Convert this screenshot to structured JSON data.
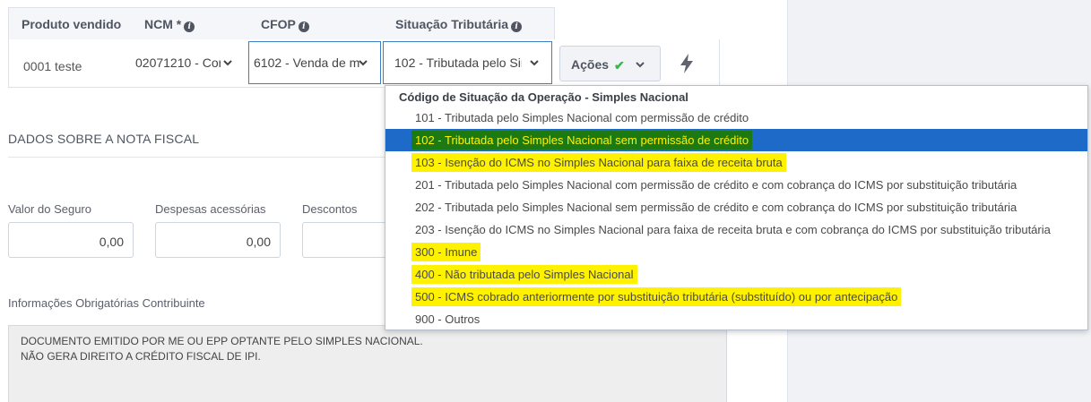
{
  "table": {
    "headers": {
      "produto": "Produto vendido",
      "ncm": "NCM *",
      "cfop": "CFOP",
      "situacao": "Situação Tributária"
    },
    "row": {
      "produto": "0001 teste",
      "ncm": "02071210 - Cor",
      "cfop": "6102 - Venda de m",
      "situacao": "102 - Tributada pelo Sir"
    },
    "acoes_label": "Ações"
  },
  "section": {
    "title": "DADOS SOBRE A NOTA FISCAL"
  },
  "fields": {
    "seguro_label": "Valor do Seguro",
    "seguro_value": "0,00",
    "despesas_label": "Despesas acessórias",
    "despesas_value": "0,00",
    "descontos_label": "Descontos"
  },
  "info": {
    "label": "Informações Obrigatórias Contribuinte",
    "line1": "DOCUMENTO EMITIDO POR ME OU EPP OPTANTE PELO SIMPLES NACIONAL.",
    "line2": "NÃO GERA DIREITO A CRÉDITO FISCAL DE IPI."
  },
  "dropdown": {
    "group": "Código de Situação da Operação - Simples Nacional",
    "options": [
      {
        "label": "101 - Tributada pelo Simples Nacional com permissão de crédito",
        "state": "normal"
      },
      {
        "label": "102 - Tributada pelo Simples Nacional sem permissão de crédito",
        "state": "selected"
      },
      {
        "label": "103 - Isenção do ICMS no Simples Nacional para faixa de receita bruta",
        "state": "highlighted"
      },
      {
        "label": "201 - Tributada pelo Simples Nacional com permissão de crédito e com cobrança do ICMS por substituição tributária",
        "state": "normal"
      },
      {
        "label": "202 - Tributada pelo Simples Nacional sem permissão de crédito e com cobrança do ICMS por substituição tributária",
        "state": "normal"
      },
      {
        "label": "203 - Isenção do ICMS no Simples Nacional para faixa de receita bruta e com cobrança do ICMS por substituição tributária",
        "state": "normal"
      },
      {
        "label": "300 - Imune",
        "state": "highlighted"
      },
      {
        "label": "400 - Não tributada pelo Simples Nacional",
        "state": "highlighted"
      },
      {
        "label": "500 - ICMS cobrado anteriormente por substituição tributária (substituído) ou por antecipação",
        "state": "highlighted"
      },
      {
        "label": "900 - Outros",
        "state": "normal"
      }
    ]
  },
  "icons": {
    "info": "info-icon",
    "chevron": "chevron-down-icon",
    "check": "check-icon",
    "bolt": "lightning-bolt-icon"
  },
  "colors": {
    "selected_row": "#1e6ac9",
    "selected_text_bg": "#1d7a12",
    "highlight": "#fff200",
    "check": "#3bb54a"
  }
}
